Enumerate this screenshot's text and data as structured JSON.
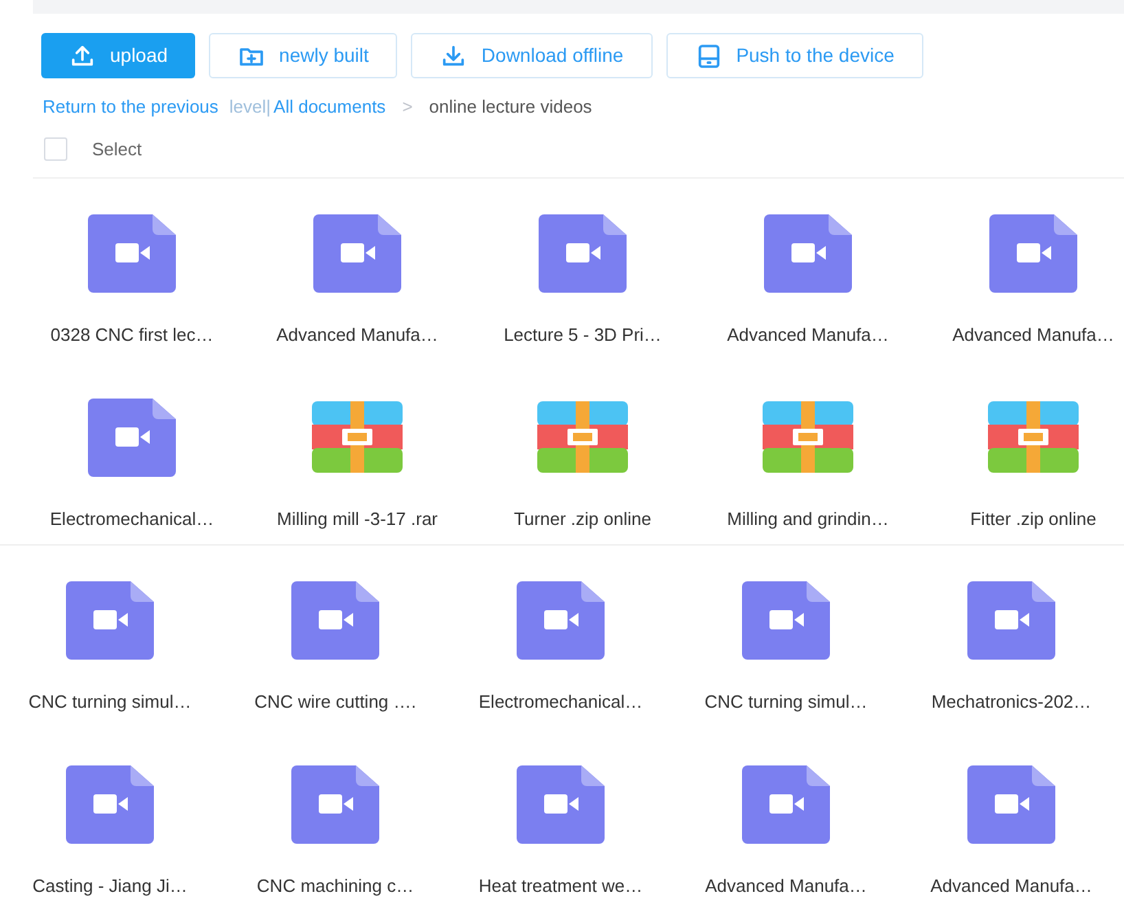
{
  "toolbar": [
    {
      "kind": "upload",
      "label": "upload",
      "primary": true
    },
    {
      "kind": "new-folder",
      "label": "newly built",
      "primary": false
    },
    {
      "kind": "download",
      "label": "Download offline",
      "primary": false
    },
    {
      "kind": "push",
      "label": "Push to the device",
      "primary": false
    }
  ],
  "breadcrumb": [
    {
      "kind": "link",
      "text": "Return to the previous"
    },
    {
      "kind": "muted",
      "text": "level|"
    },
    {
      "kind": "link",
      "text": "All documents"
    },
    {
      "kind": "separator",
      "text": ">"
    },
    {
      "kind": "current",
      "text": "online lecture videos"
    }
  ],
  "select": {
    "label": "Select",
    "checked": false
  },
  "sections": [
    [
      {
        "kind": "video",
        "name": "0328 CNC first lec…"
      },
      {
        "kind": "video",
        "name": "Advanced Manufa…"
      },
      {
        "kind": "video",
        "name": "Lecture 5 - 3D Pri…"
      },
      {
        "kind": "video",
        "name": "Advanced Manufa…"
      },
      {
        "kind": "video",
        "name": "Advanced Manufa…"
      },
      {
        "kind": "video",
        "name": "Electromechanical…"
      },
      {
        "kind": "archive",
        "name": "Milling mill -3-17 .rar"
      },
      {
        "kind": "archive",
        "name": "Turner .zip online"
      },
      {
        "kind": "archive",
        "name": "Milling and grindin…"
      },
      {
        "kind": "archive",
        "name": "Fitter .zip online"
      }
    ],
    [
      {
        "kind": "video",
        "name": "CNC turning simul…"
      },
      {
        "kind": "video",
        "name": "CNC wire cutting …."
      },
      {
        "kind": "video",
        "name": "Electromechanical…"
      },
      {
        "kind": "video",
        "name": "CNC turning simul…"
      },
      {
        "kind": "video",
        "name": "Mechatronics-202…"
      },
      {
        "kind": "video",
        "name": "Casting - Jiang Ji…"
      },
      {
        "kind": "video",
        "name": "CNC machining c…"
      },
      {
        "kind": "video",
        "name": "Heat treatment we…"
      },
      {
        "kind": "video",
        "name": "Advanced Manufa…"
      },
      {
        "kind": "video",
        "name": "Advanced Manufa…"
      }
    ]
  ]
}
